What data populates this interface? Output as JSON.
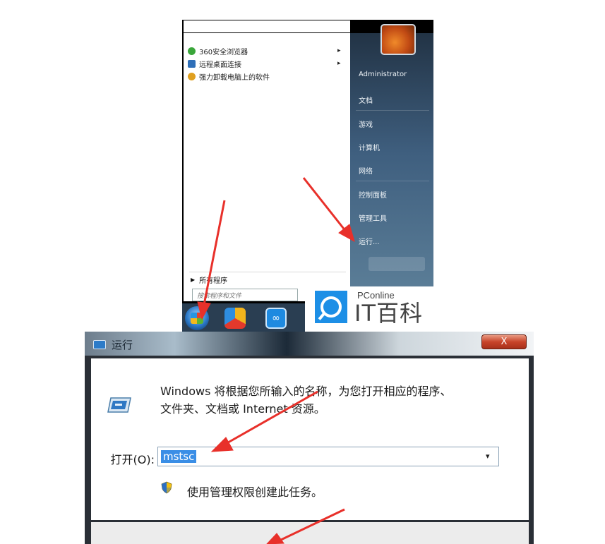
{
  "start_menu": {
    "programs": [
      {
        "label": "360安全浏览器",
        "has_submenu": true,
        "icon": "browser-icon",
        "color": "#3aa63a"
      },
      {
        "label": "远程桌面连接",
        "has_submenu": true,
        "icon": "remote-desktop-icon",
        "color": "#2f6fb8"
      },
      {
        "label": "强力卸载电脑上的软件",
        "has_submenu": false,
        "icon": "uninstall-icon",
        "color": "#e0a020"
      }
    ],
    "submenu_arrow": "▸",
    "all_programs_label": "所有程序",
    "all_programs_arrow": "▶",
    "search_placeholder": "搜索程序和文件",
    "right_items": [
      "Administrator",
      "文档",
      "游戏",
      "计算机",
      "网络",
      "控制面板",
      "管理工具",
      "运行..."
    ]
  },
  "taskbar": {
    "apps": [
      "windows-start-orb-icon",
      "app-icon",
      "app-icon"
    ]
  },
  "watermark": {
    "small_text": "PConline",
    "big_text": "IT百科"
  },
  "run_dialog": {
    "title": "运行",
    "close_label": "X",
    "description_line1": "Windows 将根据您所输入的名称，为您打开相应的程序、",
    "description_line2": "文件夹、文档或 Internet 资源。",
    "open_label": "打开(O):",
    "open_value": "mstsc",
    "dropdown_caret": "▾",
    "admin_text": "使用管理权限创建此任务。"
  },
  "annotation_color": "#e8302a"
}
